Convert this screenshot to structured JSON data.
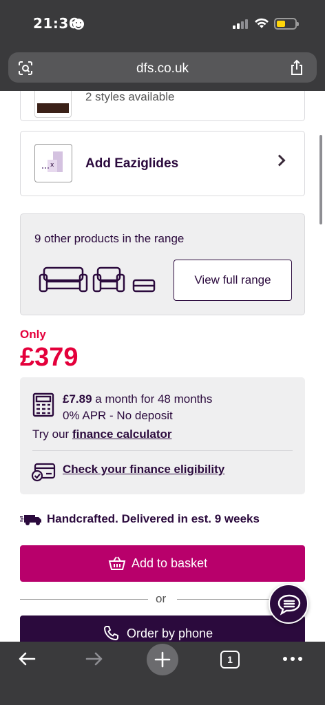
{
  "status": {
    "time": "21:36"
  },
  "browser": {
    "url": "dfs.co.uk",
    "tab_count": "1"
  },
  "product": {
    "styles_available": "2 styles available",
    "eaziglides_label": "Add Eaziglides",
    "range_text": "9 other products in the range",
    "view_range_label": "View full range",
    "only_label": "Only",
    "price": "£379"
  },
  "finance": {
    "monthly_amount": "£7.89",
    "monthly_text": " a month for 48 months",
    "apr_text": "0% APR - No deposit",
    "try_prefix": "Try our ",
    "calculator_link": "finance calculator",
    "eligibility_link": "Check your finance eligibility"
  },
  "delivery": {
    "text": "Handcrafted. Delivered in est. 9 weeks"
  },
  "actions": {
    "add_to_basket": "Add to basket",
    "or": "or",
    "order_by_phone": "Order by phone"
  },
  "colors": {
    "brand_purple": "#2b0a3d",
    "basket_pink": "#b8006b",
    "price_red": "#e4003b"
  }
}
